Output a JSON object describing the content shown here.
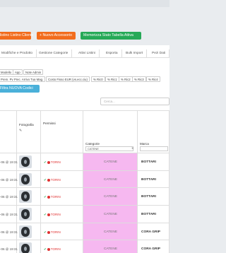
{
  "toolbar": {
    "btn_listino": "listino Listino Cliente",
    "btn_accessorio": "+ Nuovo Accessorio",
    "btn_memorizza": "Memorizza Stato Tabella Attiva",
    "btn_filtro": "Filtra NUOVA Codici"
  },
  "tabs": [
    "Modifiche e Prodotto",
    "Gestione Categorie",
    "Attivi Listini",
    "Esporta",
    "Bulk Import",
    "Pezi Dati"
  ],
  "chips_row1": [
    "Modello",
    "App",
    "Note Admin"
  ],
  "chips_row2": [
    "Prem. Pv Prec. Arrivo Tua Mag.",
    "Costo Fisso EUR (vs.ecc.ciu)",
    "% Ric0",
    "% Ric1",
    "% Ric2",
    "% Ric3",
    "% Ric4"
  ],
  "search": {
    "placeholder": "Cerca..."
  },
  "columns": {
    "fotografia": "Fotografia",
    "permissi": "Permissi",
    "categorie": "Categorie",
    "categorie_filter": "CATENE",
    "marca": "Marca"
  },
  "rows": [
    {
      "date": "-06 @ 19:31",
      "perm": "TORIN",
      "category": "CATENE",
      "brand": "BOTTARI"
    },
    {
      "date": "-06 @ 19:31",
      "perm": "TORIN",
      "category": "CATENE",
      "brand": "BOTTARI"
    },
    {
      "date": "-06 @ 19:31",
      "perm": "TORIN",
      "category": "CATENE",
      "brand": "BOTTARI"
    },
    {
      "date": "-06 @ 19:31",
      "perm": "TORIN",
      "category": "CATENE",
      "brand": "BOTTARI"
    },
    {
      "date": "-06 @ 19:31",
      "perm": "TORIN",
      "category": "CATENE",
      "brand": "CORA GRIP"
    },
    {
      "date": "-06 @ 19:31",
      "perm": "TORIN",
      "category": "CATENE",
      "brand": "CORA GRIP"
    }
  ],
  "colors": {
    "orange": "#f26c1d",
    "green": "#26a957",
    "cyan": "#4ab0d9",
    "category_bg": "#f6b8f0"
  }
}
